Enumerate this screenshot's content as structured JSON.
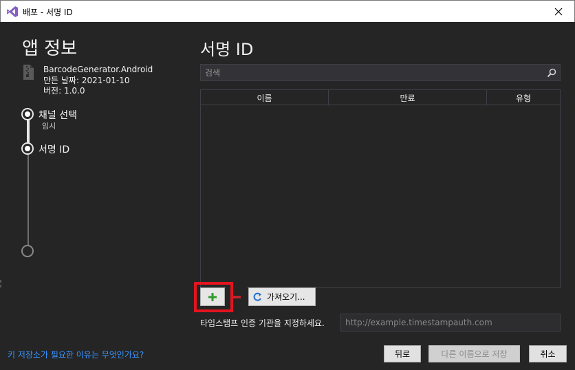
{
  "window": {
    "title": "배포 - 서명 ID",
    "close_label": "✕"
  },
  "left": {
    "heading": "앱 정보",
    "app_name": "BarcodeGenerator.Android",
    "created": "만든 날짜: 2021-01-10",
    "version": "버전: 1.0.0",
    "steps": [
      {
        "label": "채널 선택",
        "sub": "임시"
      },
      {
        "label": "서명 ID",
        "sub": ""
      }
    ],
    "help_link": "키 저장소가 필요한 이유는 무엇인가요?"
  },
  "main": {
    "heading": "서명 ID",
    "search_placeholder": "검색",
    "columns": [
      "이름",
      "만료",
      "유형"
    ],
    "import_label": "가져오기...",
    "timestamp_label": "타임스탬프 인증 기관을 지정하세요.",
    "timestamp_placeholder": "http://example.timestampauth.com"
  },
  "footer": {
    "back": "뒤로",
    "save_as": "다른 이름으로 저장",
    "cancel": "취소"
  },
  "colors": {
    "background": "#252526",
    "accent_link": "#3794ff",
    "add_green": "#2e9b2e",
    "remove_red": "#c8252c",
    "highlight_red": "#e3141e"
  }
}
